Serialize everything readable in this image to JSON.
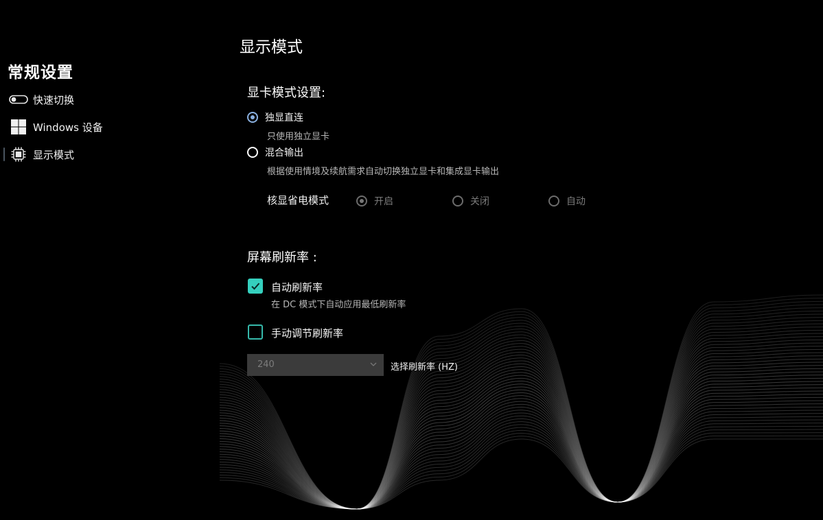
{
  "sidebar": {
    "title": "常规设置",
    "items": [
      {
        "label": "快速切换",
        "icon": "toggle-icon"
      },
      {
        "label": "Windows 设备",
        "icon": "windows-logo-icon"
      },
      {
        "label": "显示模式",
        "icon": "cpu-chip-icon",
        "active": true
      }
    ]
  },
  "main": {
    "title": "显示模式",
    "gpu_section": {
      "title": "显卡模式设置:",
      "options": [
        {
          "label": "独显直连",
          "description": "只使用独立显卡",
          "selected": true
        },
        {
          "label": "混合输出",
          "description": "根据使用情境及续航需求自动切换独立显卡和集成显卡输出",
          "selected": false
        }
      ],
      "igpu_power": {
        "label": "核显省电模式",
        "options": [
          "开启",
          "关闭",
          "自动"
        ],
        "selected": "开启",
        "disabled": true
      }
    },
    "refresh_section": {
      "title": "屏幕刷新率 :",
      "auto": {
        "label": "自动刷新率",
        "description": "在 DC 模式下自动应用最低刷新率",
        "checked": true
      },
      "manual": {
        "label": "手动调节刷新率",
        "checked": false
      },
      "rate_select": {
        "value": "240",
        "caption": "选择刷新率 (HZ)",
        "disabled": true
      }
    }
  },
  "colors": {
    "background": "#000000",
    "accent_teal": "#35d0be",
    "radio_selected": "#8ab0e0",
    "select_bg": "#3b3b3b"
  }
}
